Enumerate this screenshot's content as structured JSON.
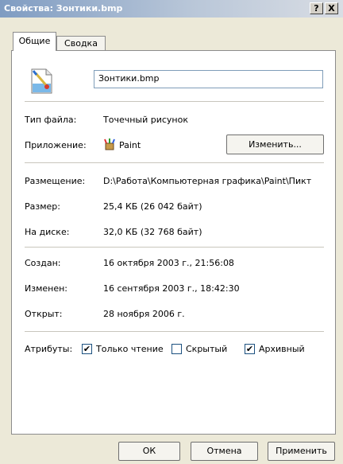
{
  "window": {
    "title": "Свойства: Зонтики.bmp",
    "help_label": "?",
    "close_label": "X"
  },
  "tabs": [
    {
      "label": "Общие",
      "active": true
    },
    {
      "label": "Сводка",
      "active": false
    }
  ],
  "file": {
    "name": "Зонтики.bmp",
    "icon": "paint-bitmap-icon"
  },
  "type": {
    "label": "Тип файла:",
    "value": "Точечный рисунок"
  },
  "app": {
    "label": "Приложение:",
    "name": "Paint",
    "icon": "paint-app-icon",
    "change_label": "Изменить..."
  },
  "location": {
    "label": "Размещение:",
    "value": "D:\\Работа\\Компьютерная графика\\Paint\\Пикт"
  },
  "size": {
    "label": "Размер:",
    "value": "25,4 КБ (26 042 байт)"
  },
  "disk": {
    "label": "На диске:",
    "value": "32,0 КБ (32 768 байт)"
  },
  "created": {
    "label": "Создан:",
    "value": "16 октября 2003 г., 21:56:08"
  },
  "modified": {
    "label": "Изменен:",
    "value": "16 сентября 2003 г., 18:42:30"
  },
  "opened": {
    "label": "Открыт:",
    "value": "28 ноября 2006 г."
  },
  "attributes": {
    "label": "Атрибуты:",
    "readonly": {
      "label": "Только чтение",
      "checked": true
    },
    "hidden": {
      "label": "Скрытый",
      "checked": false
    },
    "archive": {
      "label": "Архивный",
      "checked": true
    }
  },
  "buttons": {
    "ok": "ОК",
    "cancel": "Отмена",
    "apply": "Применить"
  }
}
